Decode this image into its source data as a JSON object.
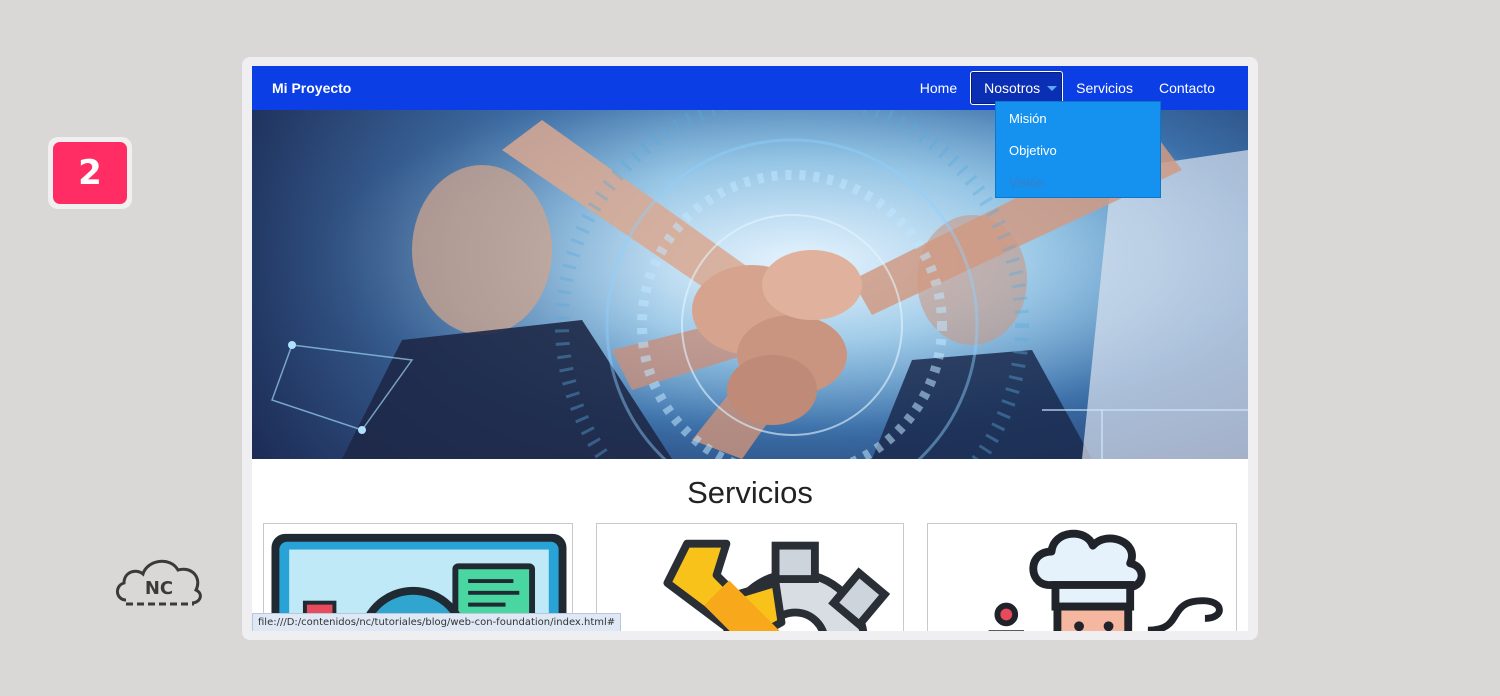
{
  "step": {
    "number": "2"
  },
  "logo": {
    "text": "NC"
  },
  "navbar": {
    "brand": "Mi Proyecto",
    "items": [
      {
        "label": "Home"
      },
      {
        "label": "Nosotros"
      },
      {
        "label": "Servicios"
      },
      {
        "label": "Contacto"
      }
    ],
    "active_item": "Nosotros"
  },
  "dropdown": {
    "items": [
      {
        "label": "Misión"
      },
      {
        "label": "Objetivo"
      },
      {
        "label": "Visión"
      }
    ]
  },
  "hero": {
    "image": "team-fist-bump-tech-overlay"
  },
  "services": {
    "title": "Servicios",
    "cards": [
      {
        "icon": "monitor-globe-icon"
      },
      {
        "icon": "wrench-gear-icon"
      },
      {
        "icon": "chef-icon"
      }
    ]
  },
  "status": {
    "url": "file:///D:/contenidos/nc/tutoriales/blog/web-con-foundation/index.html#"
  },
  "colors": {
    "navbar": "#0c3ee6",
    "dropdown": "#1592f0",
    "badge": "#ff2d64",
    "background": "#d9d8d6"
  }
}
